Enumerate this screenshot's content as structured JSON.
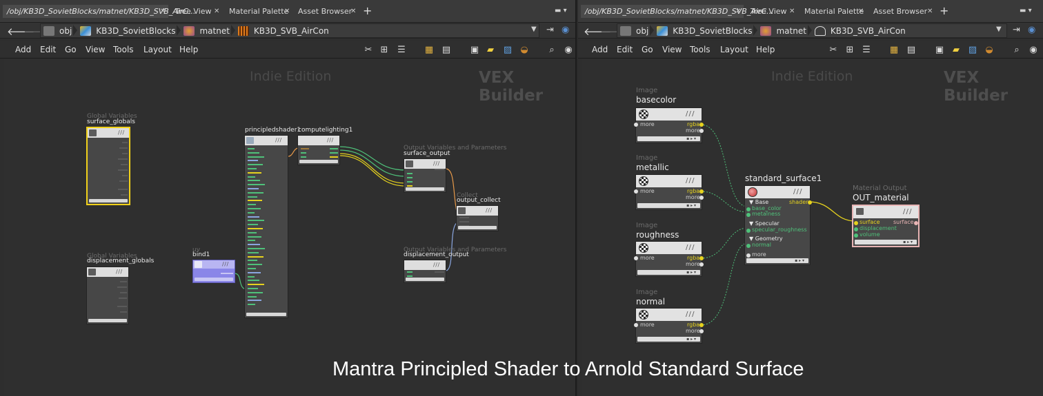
{
  "left": {
    "tabs": [
      {
        "label": "/obj/KB3D_SovietBlocks/matnet/KB3D_SVB_AirC..."
      },
      {
        "label": "Tree View"
      },
      {
        "label": "Material Palette"
      },
      {
        "label": "Asset Browser"
      }
    ],
    "breadcrumbs": [
      "obj",
      "KB3D_SovietBlocks",
      "matnet",
      "KB3D_SVB_AirCon"
    ],
    "menu": [
      "Add",
      "Edit",
      "Go",
      "View",
      "Tools",
      "Layout",
      "Help"
    ],
    "watermark": "Indie Edition",
    "context_label": "VEX Builder",
    "nodes": {
      "surface_globals": {
        "category": "Global Variables",
        "name": "surface_globals"
      },
      "displacement_globals": {
        "category": "Global Variables",
        "name": "displacement_globals"
      },
      "bind1": {
        "category": "uv",
        "name": "bind1"
      },
      "principledshader1": {
        "name": "principledshader1"
      },
      "computelighting1": {
        "name": "computelighting1"
      },
      "surface_output": {
        "category": "Output Variables and Parameters",
        "name": "surface_output"
      },
      "output_collect": {
        "category": "Collect",
        "name": "output_collect"
      },
      "displacement_output": {
        "category": "Output Variables and Parameters",
        "name": "displacement_output"
      }
    }
  },
  "right": {
    "tabs": [
      {
        "label": "/obj/KB3D_SovietBlocks/matnet/KB3D_SVB_AirC..."
      },
      {
        "label": "Tree View"
      },
      {
        "label": "Material Palette"
      },
      {
        "label": "Asset Browser"
      }
    ],
    "breadcrumbs": [
      "obj",
      "KB3D_SovietBlocks",
      "matnet",
      "KB3D_SVB_AirCon"
    ],
    "menu": [
      "Add",
      "Edit",
      "Go",
      "View",
      "Tools",
      "Layout",
      "Help"
    ],
    "watermark": "Indie Edition",
    "context_label": "VEX Builder",
    "image_nodes": [
      {
        "category": "Image",
        "name": "basecolor",
        "out": "rgba",
        "more_in": "more",
        "more_out": "more"
      },
      {
        "category": "Image",
        "name": "metallic",
        "out": "rgba",
        "more_in": "more",
        "more_out": "more"
      },
      {
        "category": "Image",
        "name": "roughness",
        "out": "rgba",
        "more_in": "more",
        "more_out": "more"
      },
      {
        "category": "Image",
        "name": "normal",
        "out": "rgba",
        "more_in": "more",
        "more_out": "more"
      }
    ],
    "standard_surface": {
      "name": "standard_surface1",
      "out": "shader",
      "groups": [
        {
          "label": "Base",
          "ports": [
            "base_color",
            "metalness"
          ]
        },
        {
          "label": "Specular",
          "ports": [
            "specular_roughness"
          ]
        },
        {
          "label": "Geometry",
          "ports": [
            "normal"
          ]
        }
      ],
      "more": "more"
    },
    "material_output": {
      "category": "Material Output",
      "name": "OUT_material",
      "inputs": [
        "surface",
        "displacement",
        "volume"
      ],
      "out": "surface"
    }
  },
  "caption": "Mantra Principled Shader to Arnold Standard Surface",
  "colors": {
    "wire_green": "#4fc17a",
    "wire_yellow": "#e6d21e",
    "wire_blue": "#8aa6e0",
    "wire_orange": "#e89a4a",
    "selected_outline": "#f2d21a",
    "bind_purple": "#8a86e8",
    "output_outline": "#e8b4b4"
  }
}
